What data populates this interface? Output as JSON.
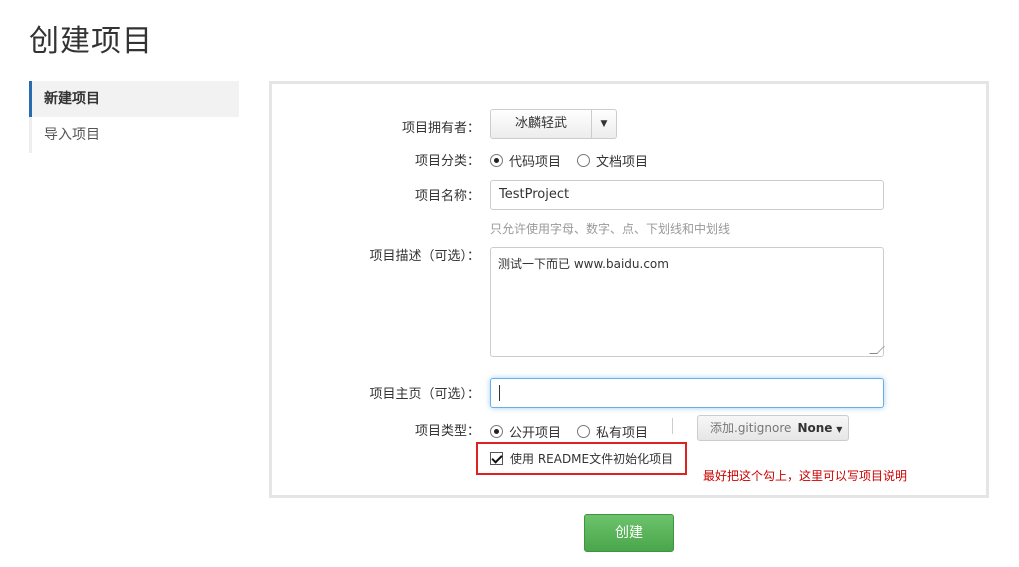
{
  "page_title": "创建项目",
  "sidebar": {
    "items": [
      {
        "label": "新建项目",
        "active": true
      },
      {
        "label": "导入项目",
        "active": false
      }
    ]
  },
  "form": {
    "owner": {
      "label": "项目拥有者：",
      "value": "冰麟轻武"
    },
    "category": {
      "label": "项目分类：",
      "options": [
        "代码项目",
        "文档项目"
      ],
      "selected": "代码项目"
    },
    "name": {
      "label": "项目名称：",
      "value": "TestProject",
      "hint": "只允许使用字母、数字、点、下划线和中划线"
    },
    "description": {
      "label": "项目描述（可选）：",
      "value": "测试一下而已 www.baidu.com"
    },
    "homepage": {
      "label": "项目主页（可选）：",
      "value": ""
    },
    "visibility": {
      "label": "项目类型：",
      "options": [
        "公开项目",
        "私有项目"
      ],
      "selected": "公开项目"
    },
    "gitignore": {
      "label": "添加.gitignore",
      "value": "None"
    },
    "readme": {
      "label": "使用 README文件初始化项目",
      "checked": true
    },
    "annotation": "最好把这个勾上，这里可以写项目说明"
  },
  "create_button": "创建",
  "colors": {
    "accent": "#2a6bb0",
    "primary_button": "#5cb85c",
    "annotation": "#cc0000"
  }
}
